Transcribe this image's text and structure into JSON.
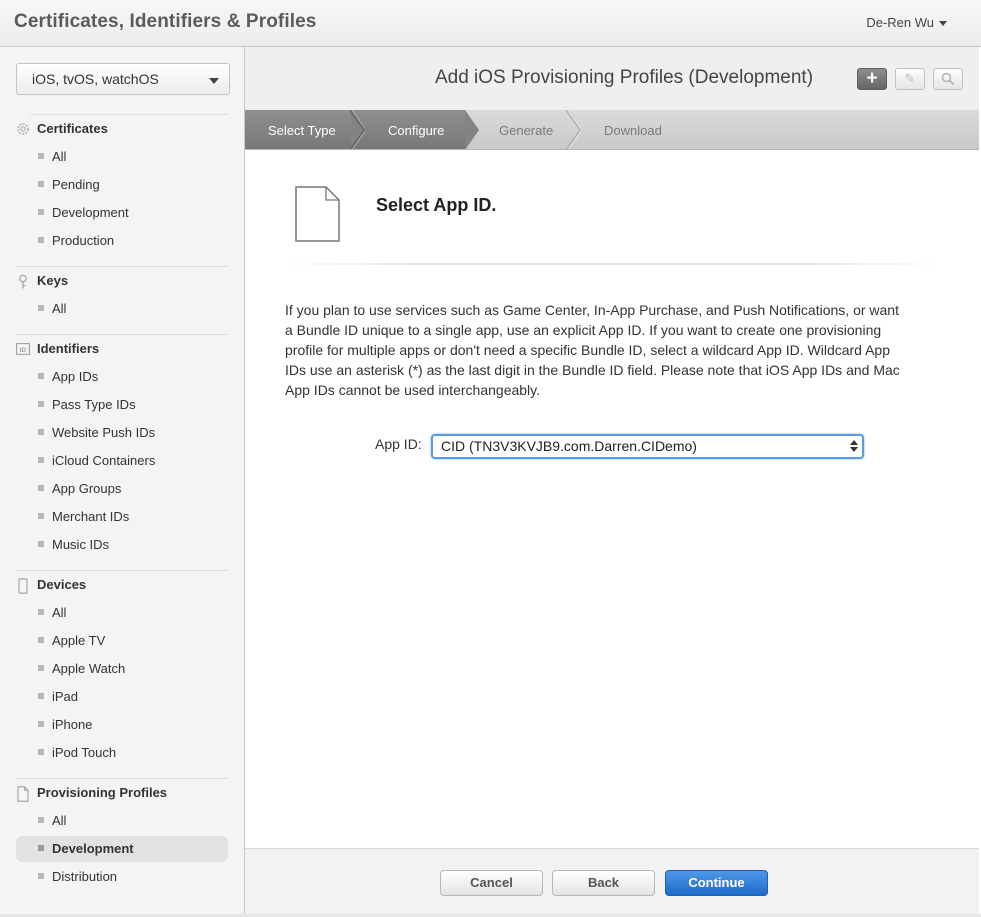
{
  "header": {
    "title": "Certificates, Identifiers & Profiles",
    "user": "De-Ren Wu"
  },
  "sidebar": {
    "platform": "iOS, tvOS, watchOS",
    "sections": {
      "certificates": {
        "label": "Certificates",
        "icon": "gear-certificate-icon",
        "items": [
          "All",
          "Pending",
          "Development",
          "Production"
        ]
      },
      "keys": {
        "label": "Keys",
        "icon": "key-icon",
        "items": [
          "All"
        ]
      },
      "identifiers": {
        "label": "Identifiers",
        "icon": "id-icon",
        "items": [
          "App IDs",
          "Pass Type IDs",
          "Website Push IDs",
          "iCloud Containers",
          "App Groups",
          "Merchant IDs",
          "Music IDs"
        ]
      },
      "devices": {
        "label": "Devices",
        "icon": "device-icon",
        "items": [
          "All",
          "Apple TV",
          "Apple Watch",
          "iPad",
          "iPhone",
          "iPod Touch"
        ]
      },
      "profiles": {
        "label": "Provisioning Profiles",
        "icon": "document-icon",
        "items": [
          "All",
          "Development",
          "Distribution"
        ],
        "active_index": 1
      }
    }
  },
  "main": {
    "title": "Add iOS Provisioning Profiles (Development)",
    "toolbar": {
      "add_icon": "+",
      "edit_icon": "✎",
      "search_icon": "⚲"
    },
    "steps": [
      "Select Type",
      "Configure",
      "Generate",
      "Download"
    ],
    "heading": "Select App ID.",
    "description": "If you plan to use services such as Game Center, In-App Purchase, and Push Notifications, or want a Bundle ID unique to a single app, use an explicit App ID. If you want to create one provisioning profile for multiple apps or don't need a specific Bundle ID, select a wildcard App ID. Wildcard App IDs use an asterisk (*) as the last digit in the Bundle ID field. Please note that iOS App IDs and Mac App IDs cannot be used interchangeably.",
    "app_id_label": "App ID:",
    "app_id_value": "CID (TN3V3KVJB9.com.Darren.CIDemo)"
  },
  "footer": {
    "cancel": "Cancel",
    "back": "Back",
    "continue": "Continue"
  },
  "colors": {
    "accent": "#2a77d4",
    "step_done": "#808080"
  }
}
